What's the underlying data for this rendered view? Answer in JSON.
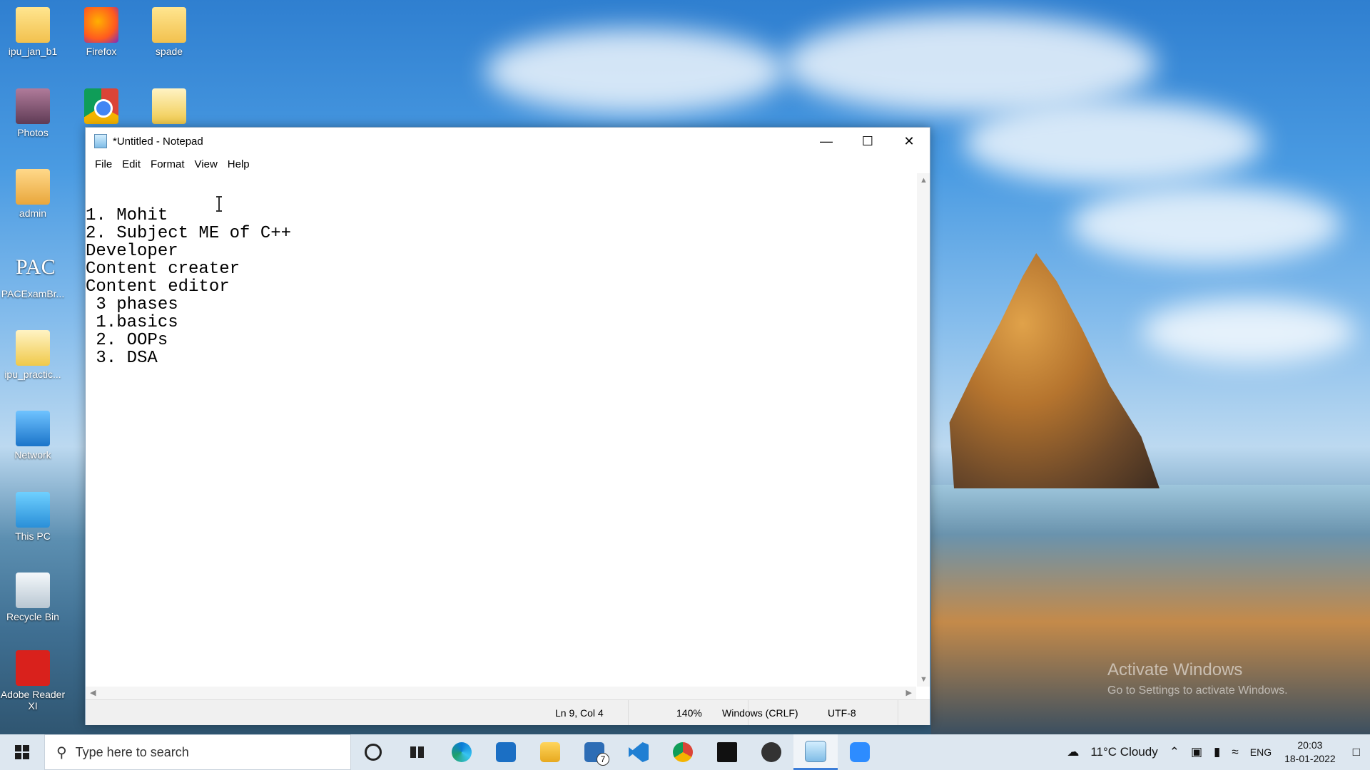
{
  "desktop_icons": [
    {
      "label": "ipu_jan_b1",
      "icon": "folder-icon"
    },
    {
      "label": "Firefox",
      "icon": "firefox-icon"
    },
    {
      "label": "spade",
      "icon": "folder-icon"
    },
    {
      "label": "Photos",
      "icon": "photos-icon"
    },
    {
      "label": "admin",
      "icon": "user-folder-icon"
    },
    {
      "label": "PACExamBr...",
      "icon": "pac-icon"
    },
    {
      "label": "ipu_practic...",
      "icon": "document-icon"
    },
    {
      "label": "Network",
      "icon": "network-icon"
    },
    {
      "label": "This PC",
      "icon": "this-pc-icon"
    },
    {
      "label": "Recycle Bin",
      "icon": "recycle-bin-icon"
    },
    {
      "label": "Adobe Reader XI",
      "icon": "adobe-reader-icon"
    }
  ],
  "notepad": {
    "title": "*Untitled - Notepad",
    "menu": [
      "File",
      "Edit",
      "Format",
      "View",
      "Help"
    ],
    "content": "\n1. Mohit\n2. Subject ME of C++\nDeveloper\nContent creater\nContent editor\n 3 phases\n 1.basics\n 2. OOPs\n 3. DSA",
    "status": {
      "position": "Ln 9, Col 4",
      "zoom": "140%",
      "line_ending": "Windows (CRLF)",
      "encoding": "UTF-8"
    }
  },
  "watermark": {
    "line1": "Activate Windows",
    "line2": "Go to Settings to activate Windows."
  },
  "taskbar": {
    "search_placeholder": "Type here to search",
    "mail_badge": "7",
    "weather": "11°C  Cloudy",
    "language": "ENG",
    "time": "20:03",
    "date": "18-01-2022"
  }
}
